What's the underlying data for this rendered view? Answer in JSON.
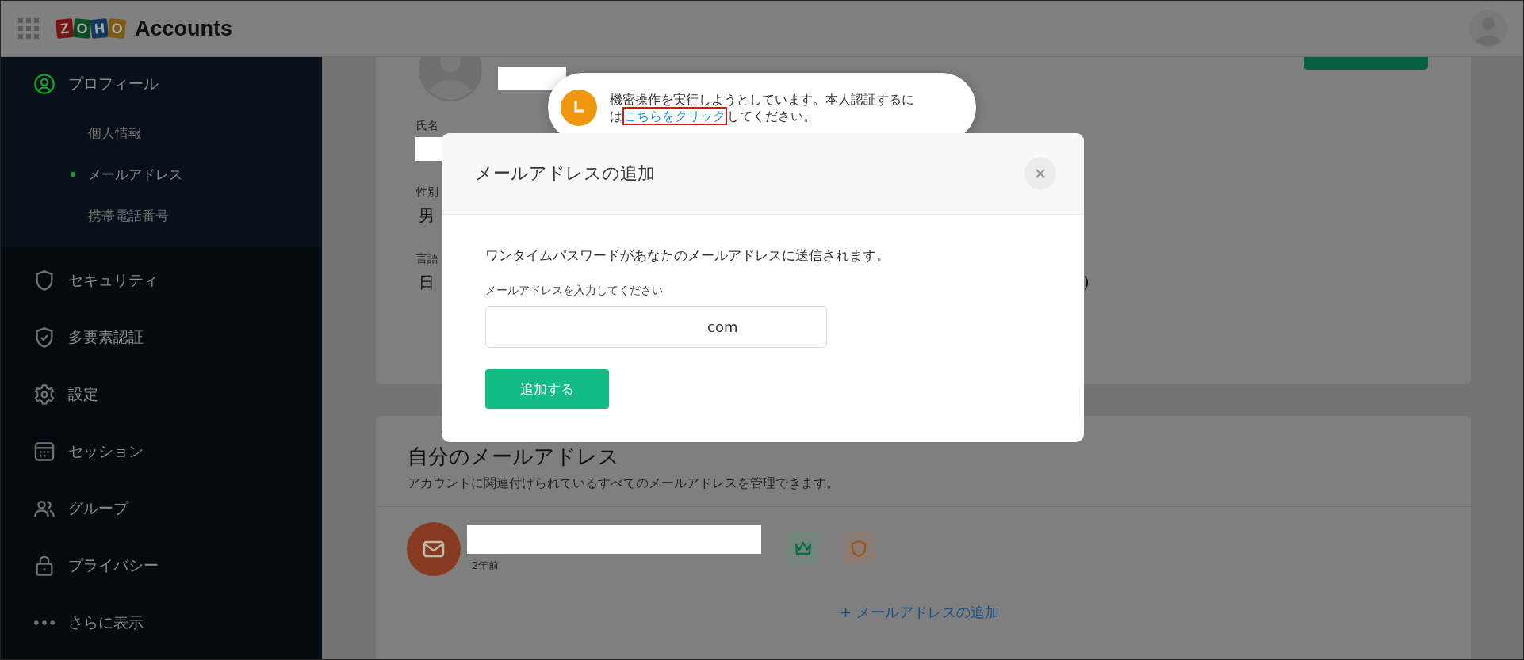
{
  "header": {
    "logo_letters": [
      "Z",
      "O",
      "H",
      "O"
    ],
    "app_name": "Accounts"
  },
  "sidebar": {
    "items": [
      {
        "label": "プロフィール",
        "selected": true,
        "children": [
          {
            "label": "個人情報",
            "selected": false
          },
          {
            "label": "メールアドレス",
            "selected": true
          },
          {
            "label": "携帯電話番号",
            "selected": false
          }
        ]
      },
      {
        "label": "セキュリティ",
        "selected": false
      },
      {
        "label": "多要素認証",
        "selected": false
      },
      {
        "label": "設定",
        "selected": false
      },
      {
        "label": "セッション",
        "selected": false
      },
      {
        "label": "グループ",
        "selected": false
      },
      {
        "label": "プライバシー",
        "selected": false
      },
      {
        "label": "さらに表示",
        "selected": false
      }
    ]
  },
  "profile_card": {
    "fields": [
      {
        "label": "氏名"
      },
      {
        "label": "性別",
        "value": "男"
      },
      {
        "label": "言語",
        "value": "日",
        "trailing": ")"
      }
    ]
  },
  "email_section": {
    "title": "自分のメールアドレス",
    "subtitle": "アカウントに関連付けられているすべてのメールアドレスを管理できます。",
    "emails": [
      {
        "age": "2年前"
      }
    ],
    "add_link": "+ メールアドレスの追加"
  },
  "toast": {
    "message_before": "機密操作を実行しようとしています。本人認証するには",
    "link": "こちらをクリック",
    "message_after": "してください。"
  },
  "modal": {
    "title": "メールアドレスの追加",
    "description": "ワンタイムパスワードがあなたのメールアドレスに送信されます。",
    "field": {
      "label": "メールアドレスを入力してください",
      "value": "com"
    },
    "submit": "追加する"
  }
}
